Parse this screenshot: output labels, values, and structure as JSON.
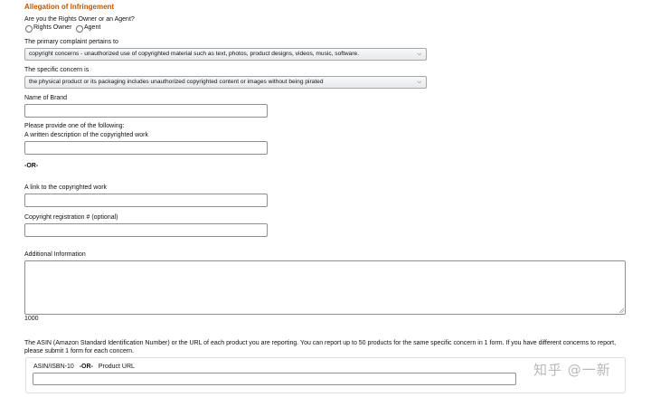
{
  "section": {
    "title": "Allegation of Infringement"
  },
  "role": {
    "question": "Are you the Rights Owner or an Agent?",
    "options": [
      "Rights Owner",
      "Agent"
    ]
  },
  "complaint": {
    "label": "The primary complaint pertains to",
    "selected": "copyright concerns - unauthorized use of copyrighted material such as text, photos, product designs, videos, music, software."
  },
  "concern": {
    "label": "The specific concern is",
    "selected": "the physical product or its packaging includes unauthorized copyrighted content or images without being pirated"
  },
  "brand": {
    "label": "Name of Brand"
  },
  "provide": {
    "instruction": "Please provide one of the following:",
    "written_label": "A written description of the copyrighted work",
    "or_text": "-OR-",
    "link_label": "A link to the copyrighted work",
    "registration_label": "Copyright registration # (optional)"
  },
  "additional": {
    "label": "Additional Information",
    "char_limit": "1000"
  },
  "asin": {
    "description": "The ASIN (Amazon Standard Identification Number) or the URL of each product you are reporting. You can report up to 50 products for the same specific concern in 1 form. If you have different concerns to report, please submit 1 form for each concern.",
    "field_label": "ASIN/ISBN-10",
    "or_text": "-OR-",
    "url_label": "Product URL"
  },
  "watermark": "知乎 @一新"
}
